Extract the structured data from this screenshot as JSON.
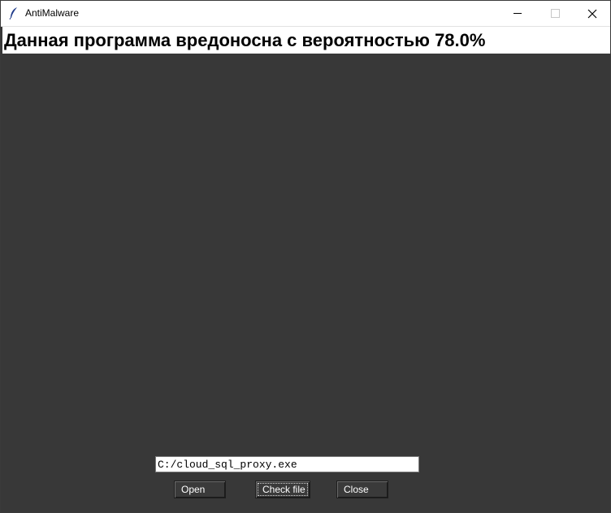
{
  "window": {
    "title": "AntiMalware",
    "icon": "feather-icon",
    "controls": {
      "minimize": "minimize-icon",
      "maximize": "maximize-icon",
      "close": "close-icon"
    }
  },
  "result": {
    "message": "Данная программа вредоносна с вероятностью 78.0%"
  },
  "file": {
    "path": "C:/cloud_sql_proxy.exe"
  },
  "buttons": {
    "open": "Open",
    "check": "Check file",
    "close": "Close"
  },
  "colors": {
    "background": "#383838",
    "button": "#3a3a3a",
    "button_text": "#ffffff"
  }
}
